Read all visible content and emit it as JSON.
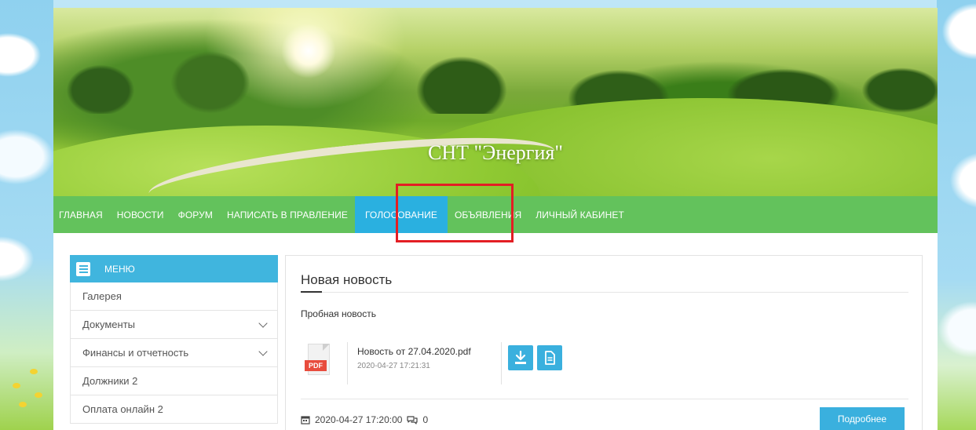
{
  "site": {
    "title": "СНТ \"Энергия\""
  },
  "nav": {
    "items": [
      {
        "label": "ГЛАВНАЯ"
      },
      {
        "label": "НОВОСТИ"
      },
      {
        "label": "ФОРУМ"
      },
      {
        "label": "НАПИСАТЬ В ПРАВЛЕНИЕ"
      },
      {
        "label": "ГОЛОСОВАНИЕ"
      },
      {
        "label": "ОБЪЯВЛЕНИЯ"
      },
      {
        "label": "ЛИЧНЫЙ КАБИНЕТ"
      }
    ],
    "active_index": 4,
    "highlighted_index": 4
  },
  "sidebar": {
    "header": "МЕНЮ",
    "items": [
      {
        "label": "Галерея",
        "has_submenu": false
      },
      {
        "label": "Документы",
        "has_submenu": true
      },
      {
        "label": "Финансы и отчетность",
        "has_submenu": true
      },
      {
        "label": "Должники 2",
        "has_submenu": false
      },
      {
        "label": "Оплата онлайн 2",
        "has_submenu": false
      }
    ]
  },
  "news": {
    "title": "Новая новость",
    "text": "Пробная новость",
    "attachment": {
      "type_label": "PDF",
      "filename": "Новость от 27.04.2020.pdf",
      "date": "2020-04-27 17:21:31"
    },
    "published": "2020-04-27 17:20:00",
    "comments_count": "0",
    "more_label": "Подробнее"
  },
  "colors": {
    "nav_green": "#63c25c",
    "accent_blue": "#2ab0e0",
    "highlight_red": "#e31e24",
    "pdf_red": "#e84c3d"
  },
  "icons": [
    "menu-icon",
    "chevron-down-icon",
    "pdf-file-icon",
    "download-icon",
    "document-icon",
    "calendar-icon",
    "comments-icon"
  ]
}
